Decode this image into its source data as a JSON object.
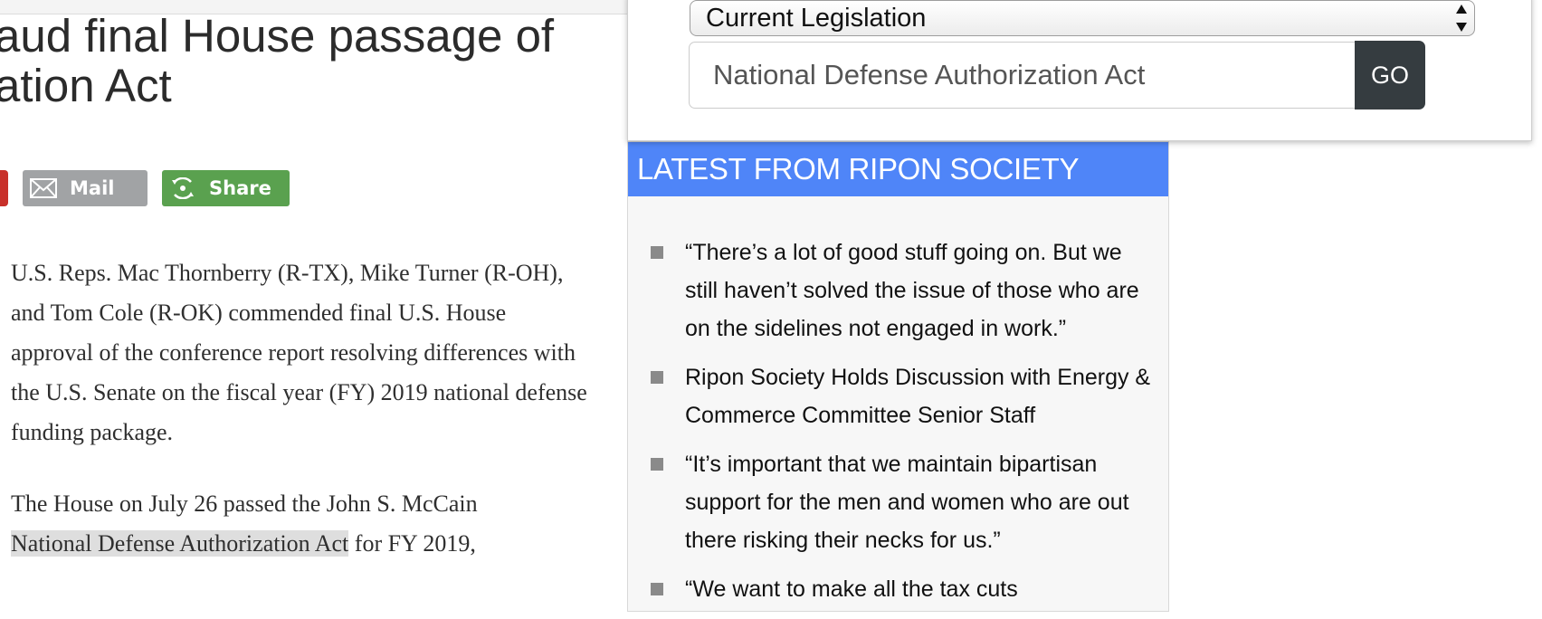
{
  "article": {
    "headline_line1": "aud final House passage of",
    "headline_line2": "ation Act",
    "share_buttons": {
      "mail_label": "Mail",
      "share_label": "Share"
    },
    "paragraph1": "U.S. Reps. Mac Thornberry (R-TX), Mike Turner (R-OH), and Tom Cole (R-OK) commended final U.S. House approval of the conference report resolving differences with the U.S. Senate on the fiscal year (FY) 2019 national defense funding package.",
    "paragraph2_before": "The House on July 26 passed the John S. McCain",
    "paragraph2_highlight": "National Defense Authorization Act",
    "paragraph2_after": " for FY 2019,"
  },
  "popup": {
    "select_value": "Current Legislation",
    "search_value": "National Defense Authorization Act",
    "go_label": "GO"
  },
  "sidebar": {
    "header": "LATEST FROM RIPON SOCIETY",
    "items": [
      "“There’s a lot of good stuff going on. But we still haven’t solved the issue of those who are on the sidelines not engaged in work.”",
      "Ripon Society Holds Discussion with Energy & Commerce Committee Senior Staff",
      "“It’s important that we maintain bipartisan support for the men and women who are out there risking their necks for us.”",
      "“We want to make all the tax cuts"
    ]
  },
  "colors": {
    "widget_header": "#4f85f8",
    "go_button": "#353c40",
    "mail_button": "#a1a3a5",
    "share_button": "#5aa14f",
    "highlight": "#dedede"
  },
  "icons": [
    "envelope-icon",
    "share-icon",
    "select-arrows-icon",
    "list-bullet-icon"
  ]
}
